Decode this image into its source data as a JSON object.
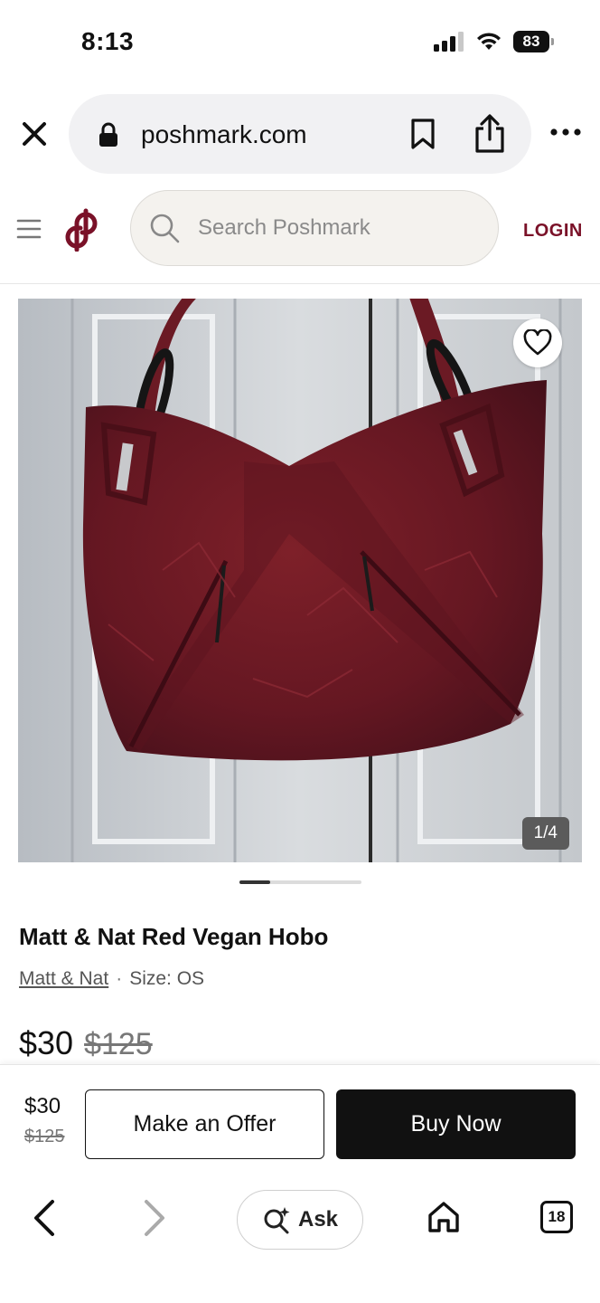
{
  "status_bar": {
    "time": "8:13",
    "battery": "83",
    "icons": [
      "signal-icon",
      "wifi-icon",
      "battery-icon"
    ]
  },
  "browser": {
    "url": "poshmark.com",
    "icons": [
      "close-icon",
      "lock-icon",
      "bookmark-icon",
      "share-icon",
      "more-icon"
    ]
  },
  "header": {
    "search_placeholder": "Search Poshmark",
    "login_label": "LOGIN",
    "icons": [
      "menu-icon",
      "poshmark-logo-icon",
      "search-icon"
    ],
    "brand_color": "#7a1128"
  },
  "gallery": {
    "counter": "1/4",
    "current_image": 1,
    "total_images": 4,
    "icons": [
      "heart-icon"
    ]
  },
  "product": {
    "title": "Matt & Nat Red Vegan Hobo",
    "brand": "Matt & Nat",
    "separator": "·",
    "size": "Size: OS",
    "price": "$30",
    "original_price": "$125"
  },
  "buy_bar": {
    "price": "$30",
    "original_price": "$125",
    "offer_label": "Make an Offer",
    "buy_label": "Buy Now"
  },
  "bottom_toolbar": {
    "ask_label": "Ask",
    "tab_count": "18",
    "icons": [
      "back-icon",
      "forward-icon",
      "ai-search-icon",
      "home-icon",
      "tabs-icon"
    ]
  }
}
